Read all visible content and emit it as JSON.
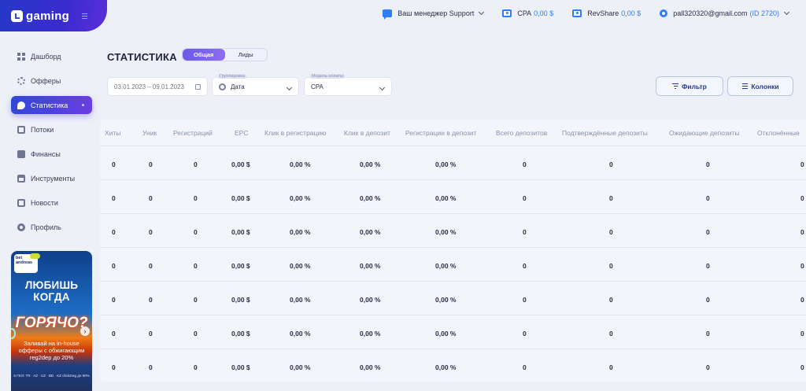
{
  "brand": {
    "name": "gaming"
  },
  "topbar": {
    "manager_label": "Ваш менеджер",
    "manager_name": "Support",
    "cpa_label": "CPA",
    "cpa_value": "0,00 $",
    "revshare_label": "RevShare",
    "revshare_value": "0,00 $",
    "email": "pall320320@gmail.com",
    "user_id": "(ID 2720)"
  },
  "sidebar": {
    "items": [
      {
        "label": "Дашборд",
        "icon": "dashboard-icon",
        "active": false
      },
      {
        "label": "Офферы",
        "icon": "offers-icon",
        "active": false
      },
      {
        "label": "Статистика",
        "icon": "statistics-icon",
        "active": true
      },
      {
        "label": "Потоки",
        "icon": "flows-icon",
        "active": false
      },
      {
        "label": "Финансы",
        "icon": "finance-icon",
        "active": false
      },
      {
        "label": "Инструменты",
        "icon": "tools-icon",
        "active": false
      },
      {
        "label": "Новости",
        "icon": "news-icon",
        "active": false
      },
      {
        "label": "Профиль",
        "icon": "profile-icon",
        "active": false
      }
    ]
  },
  "promo": {
    "logo_text": "bet andreas",
    "line1": "ЛЮБИШЬ",
    "line2": "КОГДА",
    "hot": "ГОРЯЧО?",
    "text": "Заливай на in-house офферы с обжигающим reg2dep до 20%",
    "geo": "5 ГЕО: TR · AZ · UZ · BD · KZ click2reg до 90%"
  },
  "main": {
    "title": "СТАТИСТИКА",
    "tabs": [
      {
        "label": "Общая",
        "active": true
      },
      {
        "label": "Лиды",
        "active": false
      }
    ],
    "filters": {
      "date_placeholder": "03.01.2023 – 09.01.2023",
      "group_label": "Группировка",
      "group_value": "Дата",
      "payment_label": "Модель оплаты",
      "payment_value": "CPA"
    },
    "buttons": {
      "filter": "Фильтр",
      "columns": "Колонки"
    }
  },
  "table": {
    "headers": [
      "Хиты",
      "Уник",
      "Регистраций",
      "EPC",
      "Клик в регистрацию",
      "Клик в депозит",
      "Регистрации в депозит",
      "Всего депозитов",
      "Подтверждённые депозиты",
      "Ожидающие депозиты",
      "Отклонённые"
    ],
    "rows": [
      [
        "0",
        "0",
        "0",
        "0,00 $",
        "0,00 %",
        "0,00 %",
        "0,00 %",
        "0",
        "0",
        "0",
        "0"
      ],
      [
        "0",
        "0",
        "0",
        "0,00 $",
        "0,00 %",
        "0,00 %",
        "0,00 %",
        "0",
        "0",
        "0",
        "0"
      ],
      [
        "0",
        "0",
        "0",
        "0,00 $",
        "0,00 %",
        "0,00 %",
        "0,00 %",
        "0",
        "0",
        "0",
        "0"
      ],
      [
        "0",
        "0",
        "0",
        "0,00 $",
        "0,00 %",
        "0,00 %",
        "0,00 %",
        "0",
        "0",
        "0",
        "0"
      ],
      [
        "0",
        "0",
        "0",
        "0,00 $",
        "0,00 %",
        "0,00 %",
        "0,00 %",
        "0",
        "0",
        "0",
        "0"
      ],
      [
        "0",
        "0",
        "0",
        "0,00 $",
        "0,00 %",
        "0,00 %",
        "0,00 %",
        "0",
        "0",
        "0",
        "0"
      ],
      [
        "0",
        "0",
        "0",
        "0,00 $",
        "0,00 %",
        "0,00 %",
        "0,00 %",
        "0",
        "0",
        "0",
        "0"
      ]
    ]
  },
  "colors": {
    "accent": "#2f7ef5",
    "brand": "#2d3fd0",
    "active_nav": "#4f46e5"
  }
}
